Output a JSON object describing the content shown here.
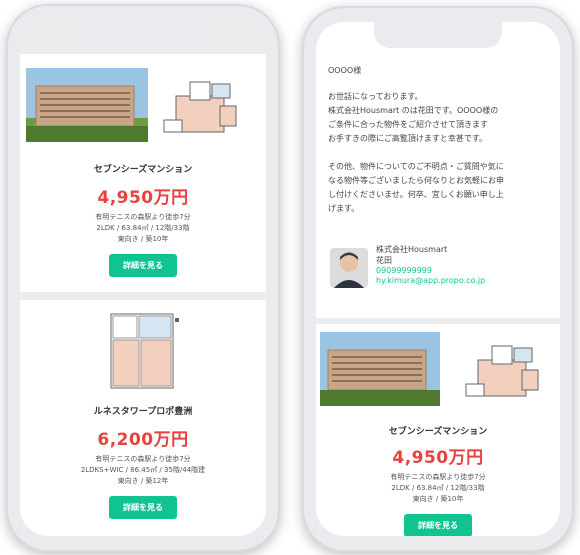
{
  "left_phone": {
    "card1": {
      "name": "セブンシーズマンション",
      "price": "4,950万円",
      "access": "有明テニスの森駅より徒歩7分",
      "spec": "2LDK / 63.84㎡ / 12階/33階",
      "orientation": "東向き / 築10年",
      "button": "詳細を見る"
    },
    "card2": {
      "name": "ルネスタワープロポ豊洲",
      "price": "6,200万円",
      "access": "有明テニスの森駅より徒歩7分",
      "spec": "2LDKS+WIC / 86.45㎡ / 35階/44階建",
      "orientation": "東向き / 築12年",
      "button": "詳細を見る"
    }
  },
  "right_phone": {
    "greeting": "OOOO様",
    "paragraph1": [
      "お世話になっております。",
      "株式会社Housmart のは花田です。OOOO様の",
      "ご条件に合った物件をご紹介させて頂きます",
      "お手すきの際にご高覧頂けますと幸甚です。"
    ],
    "paragraph2": [
      "その他、物件についてのご不明点・ご質問や気に",
      "なる物件等ございましたら何なりとお気軽にお申",
      "し付けくださいませ。何卒、宜しくお願い申し上",
      "げます。"
    ],
    "agent": {
      "company": "株式会社Housmart",
      "name": "花田",
      "phone": "09099999999",
      "email": "hy.kimura@app.propo.co.jp"
    },
    "card": {
      "name": "セブンシーズマンション",
      "price": "4,950万円",
      "access": "有明テニスの森駅より徒歩7分",
      "spec": "2LDK / 63.84㎡ / 12階/33階",
      "orientation": "東向き / 築10年",
      "button": "詳細を見る"
    }
  },
  "colors": {
    "accent_green": "#12c392",
    "price_red": "#e8423f"
  }
}
